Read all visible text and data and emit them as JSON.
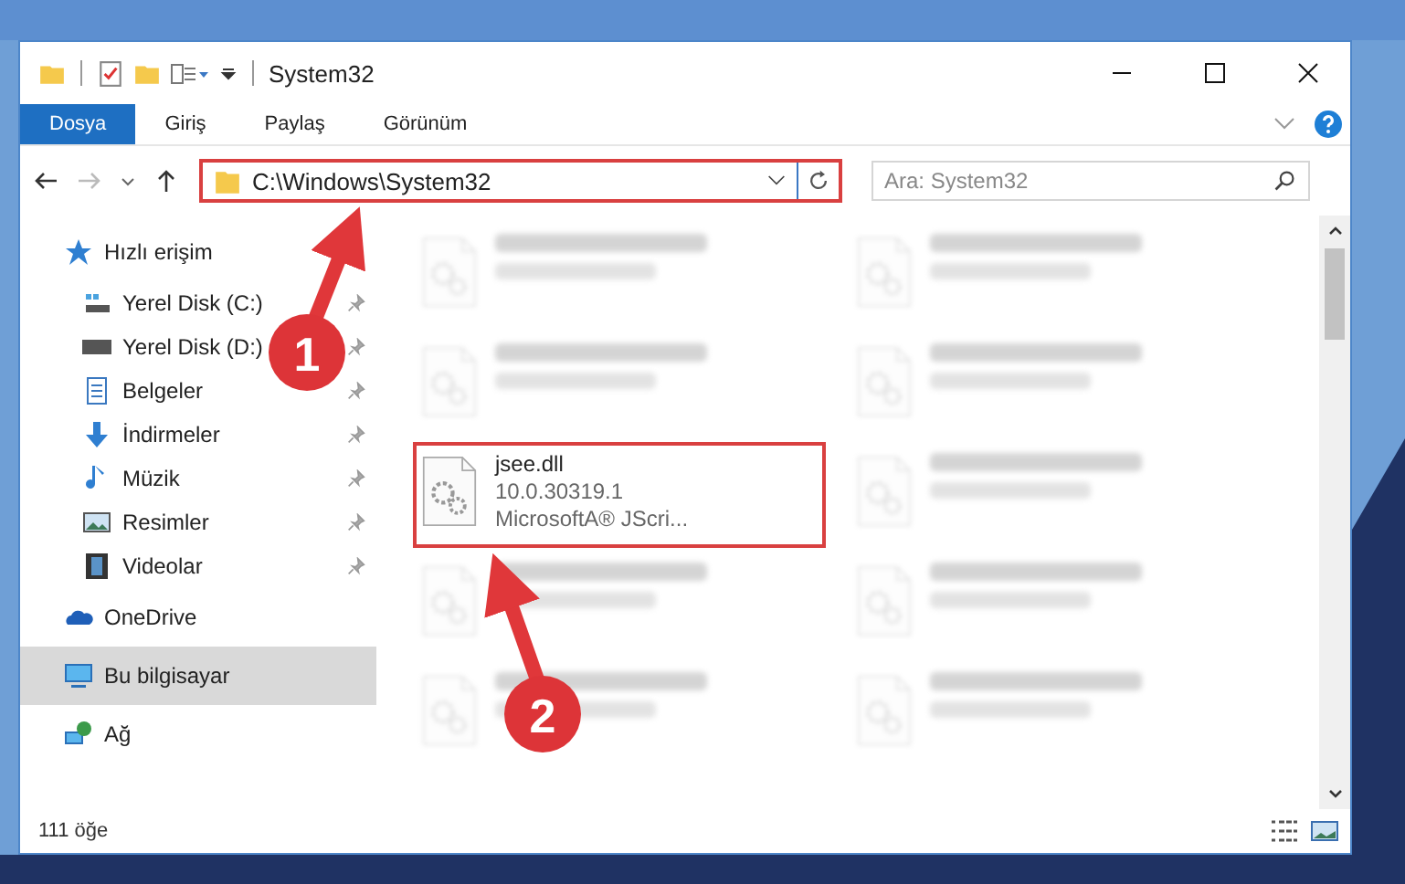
{
  "window": {
    "title": "System32"
  },
  "ribbon_tabs": [
    {
      "label": "Dosya",
      "selected": true
    },
    {
      "label": "Giriş",
      "selected": false
    },
    {
      "label": "Paylaş",
      "selected": false
    },
    {
      "label": "Görünüm",
      "selected": false
    }
  ],
  "address": {
    "path": "C:\\Windows\\System32",
    "highlighted": true
  },
  "search": {
    "placeholder": "Ara: System32"
  },
  "sidebar": {
    "items": [
      {
        "label": "Hızlı erişim",
        "selected": false,
        "children": [
          {
            "label": "Yerel Disk (C:)",
            "pinned": true,
            "selected": false
          },
          {
            "label": "Yerel Disk (D:)",
            "pinned": true,
            "selected": false
          },
          {
            "label": "Belgeler",
            "pinned": true,
            "selected": false
          },
          {
            "label": "İndirmeler",
            "pinned": true,
            "selected": false
          },
          {
            "label": "Müzik",
            "pinned": true,
            "selected": false
          },
          {
            "label": "Resimler",
            "pinned": true,
            "selected": false
          },
          {
            "label": "Videolar",
            "pinned": true,
            "selected": false
          }
        ]
      },
      {
        "label": "OneDrive",
        "selected": false
      },
      {
        "label": "Bu bilgisayar",
        "selected": true
      },
      {
        "label": "Ağ",
        "selected": false
      }
    ]
  },
  "files": [
    {
      "blurred": true,
      "highlighted": false
    },
    {
      "blurred": true,
      "highlighted": false
    },
    {
      "blurred": true,
      "highlighted": false
    },
    {
      "blurred": true,
      "highlighted": false
    },
    {
      "name": "jsee.dll",
      "lines": [
        "10.0.30319.1",
        "MicrosoftA® JScri..."
      ],
      "blurred": false,
      "highlighted": true
    },
    {
      "blurred": true,
      "highlighted": false
    },
    {
      "blurred": true,
      "highlighted": false
    },
    {
      "blurred": true,
      "highlighted": false
    },
    {
      "blurred": true,
      "highlighted": false
    },
    {
      "blurred": true,
      "highlighted": false
    }
  ],
  "status_bar": {
    "item_count": "111 öğe"
  },
  "step_markers": [
    {
      "label": "1"
    },
    {
      "label": "2"
    }
  ]
}
